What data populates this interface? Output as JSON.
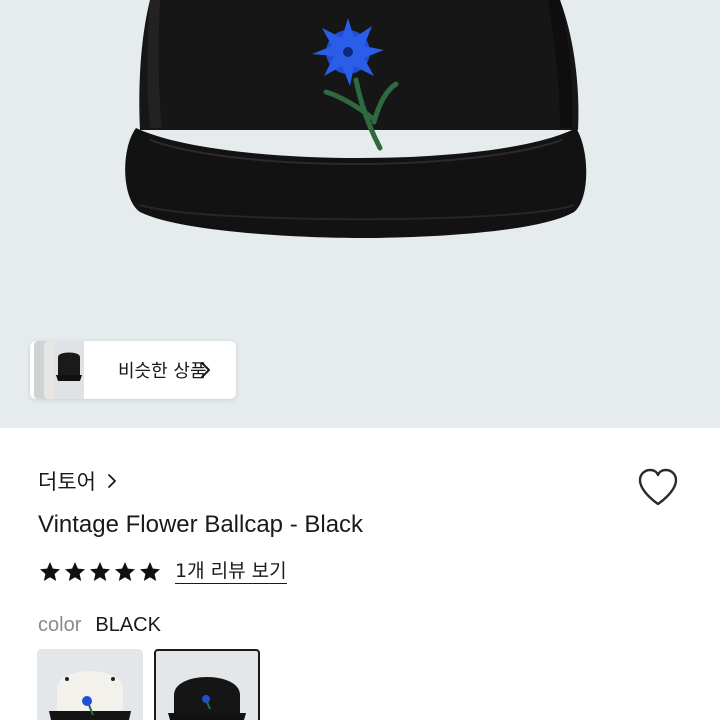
{
  "hero": {
    "similar_button_label": "비슷한 상품"
  },
  "product": {
    "brand": "더토어",
    "title": "Vintage Flower Ballcap - Black",
    "rating_stars": 5,
    "review_link": "1개 리뷰 보기",
    "color_label": "color",
    "color_value": "BLACK"
  },
  "options": [
    {
      "name": "white-cap-swatch",
      "selected": false
    },
    {
      "name": "black-cap-swatch",
      "selected": true
    }
  ],
  "colors": {
    "hero_bg": "#e6ebee",
    "cap": "#141414",
    "flower": "#1f4fd6",
    "stem": "#2f6a3e",
    "star": "#111111"
  }
}
